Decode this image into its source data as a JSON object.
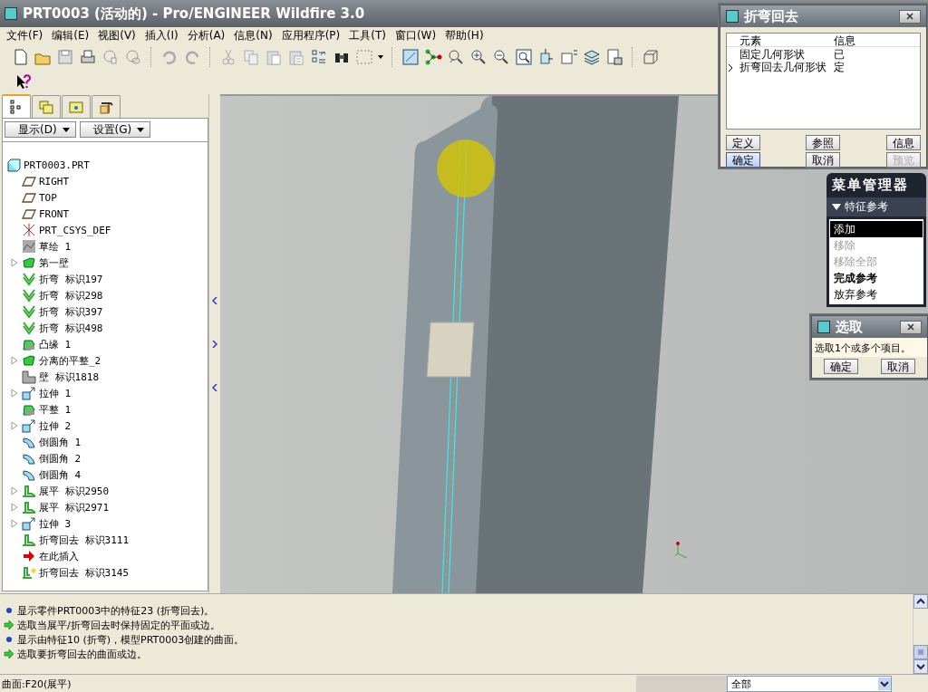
{
  "window": {
    "title": "PRT0003 (活动的) - Pro/ENGINEER Wildfire 3.0"
  },
  "menu": [
    "文件(F)",
    "编辑(E)",
    "视图(V)",
    "插入(I)",
    "分析(A)",
    "信息(N)",
    "应用程序(P)",
    "工具(T)",
    "窗口(W)",
    "帮助(H)"
  ],
  "navigator_tabs": [
    {
      "kind": "tree",
      "selected": true
    },
    {
      "kind": "folders",
      "selected": false
    },
    {
      "kind": "favorites",
      "selected": false
    },
    {
      "kind": "tools",
      "selected": false
    }
  ],
  "tree_buttons": [
    "显示(D)",
    "设置(G)"
  ],
  "model_tree": [
    {
      "label": "PRT0003.PRT",
      "kind": "part",
      "children": [
        {
          "label": "RIGHT",
          "kind": "plane"
        },
        {
          "label": "TOP",
          "kind": "plane"
        },
        {
          "label": "FRONT",
          "kind": "plane"
        },
        {
          "label": "PRT_CSYS_DEF",
          "kind": "csys"
        },
        {
          "label": "草绘 1",
          "kind": "sketch"
        },
        {
          "label": "第一壁",
          "kind": "wall",
          "expanded": false
        },
        {
          "label": "折弯 标识197",
          "kind": "bend"
        },
        {
          "label": "折弯 标识298",
          "kind": "bend"
        },
        {
          "label": "折弯 标识397",
          "kind": "bend"
        },
        {
          "label": "折弯 标识498",
          "kind": "bend"
        },
        {
          "label": "凸缘 1",
          "kind": "flange"
        },
        {
          "label": "分离的平整_2",
          "kind": "wall",
          "expanded": false
        },
        {
          "label": "壁 标识1818",
          "kind": "block"
        },
        {
          "label": "拉伸 1",
          "kind": "extrude",
          "expanded": false
        },
        {
          "label": "平整 1",
          "kind": "flange"
        },
        {
          "label": "拉伸 2",
          "kind": "extrude",
          "expanded": false
        },
        {
          "label": "倒圆角 1",
          "kind": "round"
        },
        {
          "label": "倒圆角 2",
          "kind": "round"
        },
        {
          "label": "倒圆角 4",
          "kind": "round"
        },
        {
          "label": "展平 标识2950",
          "kind": "unbend",
          "expanded": false
        },
        {
          "label": "展平 标识2971",
          "kind": "unbend",
          "expanded": false
        },
        {
          "label": "拉伸 3",
          "kind": "extrude",
          "expanded": false
        },
        {
          "label": "折弯回去 标识3111",
          "kind": "unbend"
        },
        {
          "label": "在此插入",
          "kind": "insert"
        },
        {
          "label": "折弯回去 标识3145",
          "kind": "new_unbend"
        }
      ]
    }
  ],
  "feature_dialog": {
    "title": "折弯回去",
    "columns": [
      "元素",
      "信息"
    ],
    "rows": [
      {
        "element": "固定几何形状",
        "info": "已",
        "selected": false
      },
      {
        "element": "折弯回去几何形状",
        "info": "定",
        "selected": true
      }
    ],
    "buttons": [
      {
        "label": "定义",
        "default": false,
        "disabled": false
      },
      {
        "label": "参照",
        "default": false,
        "disabled": false
      },
      {
        "label": "信息",
        "default": false,
        "disabled": false
      },
      {
        "label": "确定",
        "default": true,
        "disabled": false
      },
      {
        "label": "取消",
        "default": false,
        "disabled": false
      },
      {
        "label": "预览",
        "default": false,
        "disabled": true
      }
    ]
  },
  "menu_manager": {
    "title": "菜单管理器",
    "section": "特征参考",
    "items": [
      {
        "label": "添加",
        "selected": true,
        "disabled": false,
        "emphasized": false
      },
      {
        "label": "移除",
        "selected": false,
        "disabled": true,
        "emphasized": false
      },
      {
        "label": "移除全部",
        "selected": false,
        "disabled": true,
        "emphasized": false
      },
      {
        "label": "完成参考",
        "selected": false,
        "disabled": false,
        "emphasized": true
      },
      {
        "label": "放弃参考",
        "selected": false,
        "disabled": false,
        "emphasized": false
      }
    ]
  },
  "select_dialog": {
    "title": "选取",
    "prompt": "选取1个或多个项目。",
    "buttons": [
      "确定",
      "取消"
    ]
  },
  "messages": [
    {
      "kind": "info",
      "text": "显示零件PRT0003中的特征23 (折弯回去)。"
    },
    {
      "kind": "prompt",
      "text": "选取当展平/折弯回去时保持固定的平面或边。"
    },
    {
      "kind": "info",
      "text": "显示由特征10 (折弯)，模型PRT0003创建的曲面。"
    },
    {
      "kind": "prompt",
      "text": "选取要折弯回去的曲面或边。"
    }
  ],
  "status_bar": {
    "text": "曲面:F20(展平)",
    "filter": "全部"
  }
}
